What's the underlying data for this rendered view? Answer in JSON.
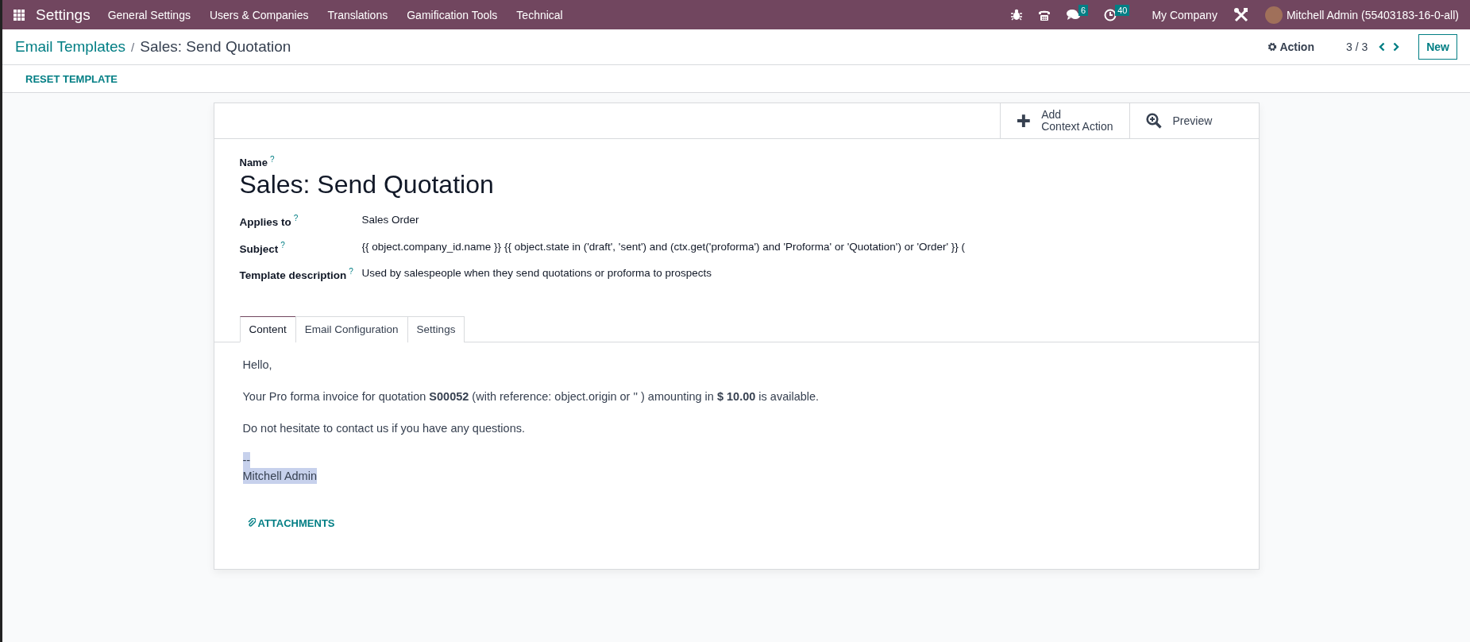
{
  "navbar": {
    "app_title": "Settings",
    "menu": [
      "General Settings",
      "Users & Companies",
      "Translations",
      "Gamification Tools",
      "Technical"
    ],
    "systray": [
      {
        "kind": "bug"
      },
      {
        "kind": "phone"
      },
      {
        "kind": "chat",
        "badge": "6"
      },
      {
        "kind": "clock",
        "badge": "40"
      }
    ],
    "company": "My Company",
    "user": "Mitchell Admin (55403183-16-0-all)"
  },
  "control_panel": {
    "breadcrumb": [
      {
        "label": "Email Templates",
        "kind": "link"
      },
      {
        "label": "Sales: Send Quotation",
        "kind": "current"
      }
    ],
    "breadcrumb_separator": "/",
    "action": "Action",
    "pager": "3 / 3",
    "new_button": "New"
  },
  "status_bar": {
    "buttons": [
      "RESET TEMPLATE"
    ]
  },
  "form": {
    "smart_buttons": [
      {
        "kind": "plus",
        "label_lines": [
          "Add",
          "Context Action"
        ]
      },
      {
        "kind": "zoom",
        "label_lines": [
          "Preview"
        ]
      }
    ],
    "name_label": "Name",
    "name_help": "?",
    "name": "Sales: Send Quotation",
    "fields": [
      {
        "label": "Applies to",
        "help": "?",
        "value": "Sales Order"
      },
      {
        "label": "Subject",
        "help": "?",
        "value": "{{ object.company_id.name }} {{ object.state in ('draft', 'sent') and (ctx.get('proforma') and 'Proforma' or 'Quotation') or 'Order' }} ("
      },
      {
        "label": "Template description",
        "help": "?",
        "value": "Used by salespeople when they send quotations or proforma to prospects"
      }
    ],
    "tabs": [
      {
        "label": "Content",
        "selected": true
      },
      {
        "label": "Email Configuration",
        "selected": false
      },
      {
        "label": "Settings",
        "selected": false
      }
    ],
    "body": [
      {
        "lines": [
          {
            "text": "Hello,",
            "highlighted": false
          }
        ]
      },
      {
        "lines": [
          {
            "text": "Your Pro forma invoice for quotation **S00052** (with reference: object.origin or '' ) amounting in **$ 10.00** is available.",
            "highlighted": false
          }
        ]
      },
      {
        "lines": [
          {
            "text": "Do not hesitate to contact us if you have any questions.",
            "highlighted": false
          }
        ]
      },
      {
        "lines": [
          {
            "text": "--",
            "highlighted": true
          },
          {
            "text": "Mitchell Admin",
            "highlighted": true
          }
        ]
      }
    ],
    "attachments": "ATTACHMENTS"
  }
}
